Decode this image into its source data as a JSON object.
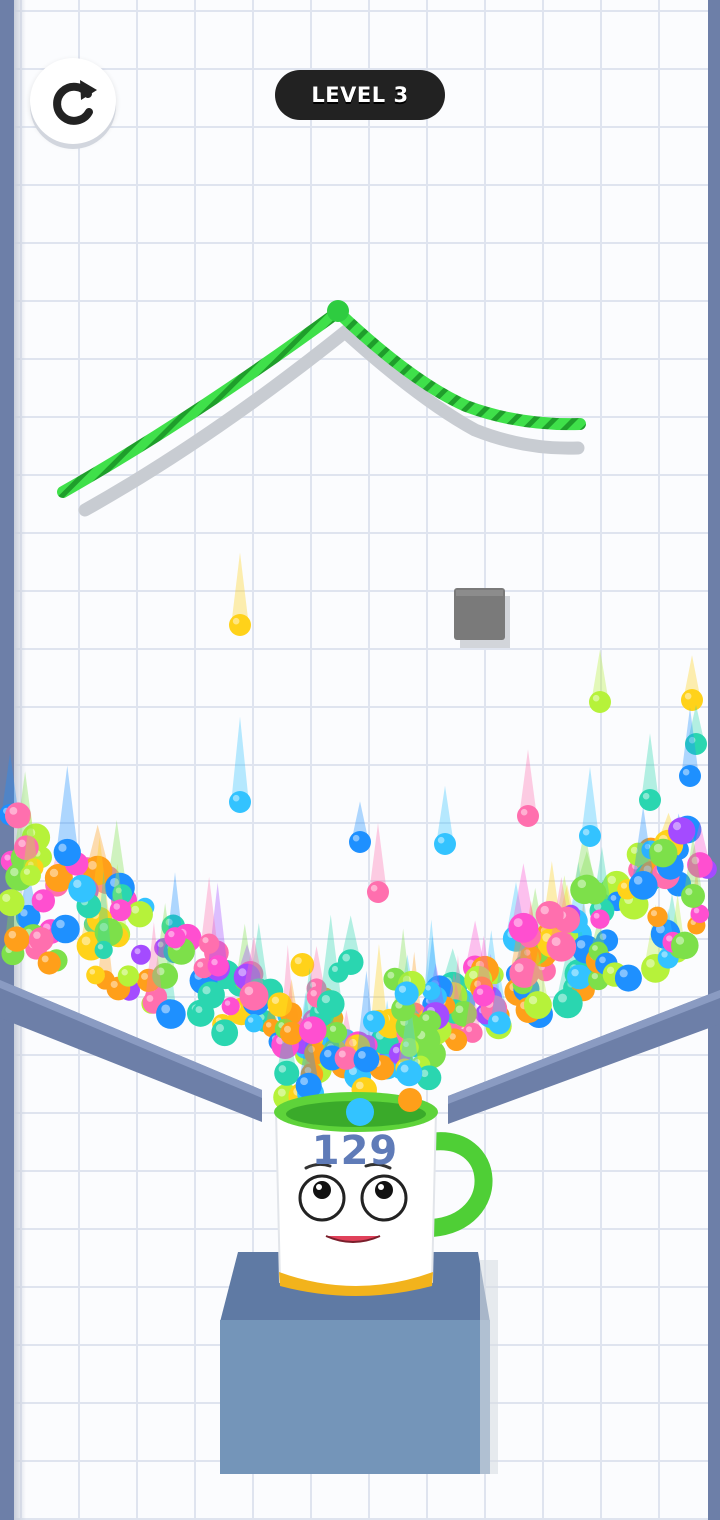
{
  "header": {
    "level_label": "LEVEL 3"
  },
  "controls": {
    "restart_icon": "restart-icon"
  },
  "cup": {
    "ball_count": "129",
    "face_icon": "smiley-face-icon"
  },
  "colors": {
    "wall": "#6d7fa8",
    "rope": "#2ecc40",
    "cup_rim": "#5ed33a",
    "cup_counter": "#5f7bb8",
    "pedestal": "#7495b9",
    "obstacle": "#7a7a7a"
  },
  "ball_palette": [
    "#ff9f1a",
    "#ffd21a",
    "#7de04a",
    "#33c3ff",
    "#ff4fd0",
    "#a44bff",
    "#2ad6b0",
    "#1e90ff",
    "#ff6fae",
    "#b6f23a"
  ]
}
